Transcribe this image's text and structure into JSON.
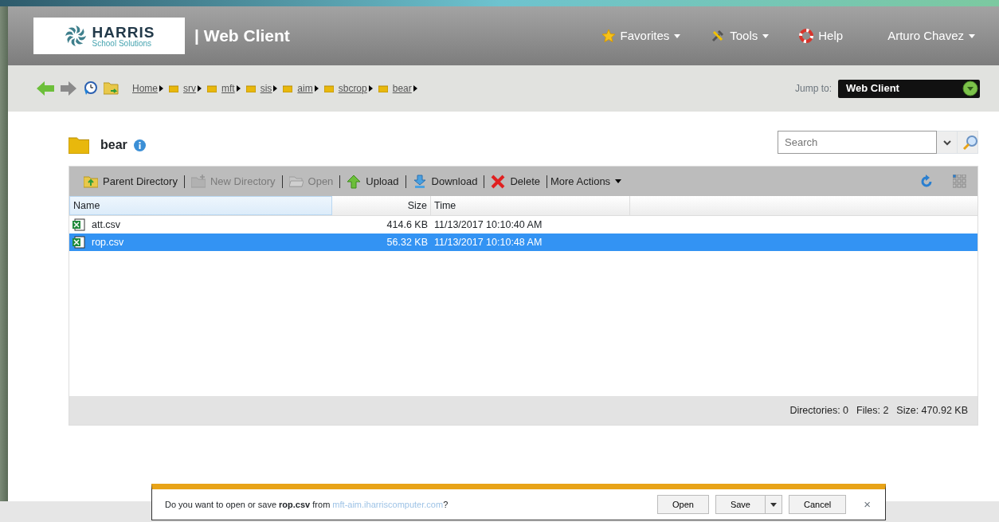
{
  "header": {
    "logo": {
      "name": "HARRIS",
      "tagline": "School Solutions"
    },
    "app_title": "| Web Client",
    "menu": [
      {
        "kind": "favorites",
        "label": "Favorites",
        "dropdown": true
      },
      {
        "kind": "tools",
        "label": "Tools",
        "dropdown": true
      },
      {
        "kind": "help",
        "label": "Help",
        "dropdown": false
      },
      {
        "kind": "user",
        "label": "Arturo Chavez",
        "dropdown": true
      }
    ]
  },
  "breadcrumb": [
    "Home",
    "srv",
    "mft",
    "sis",
    "aim",
    "sbcrop",
    "bear"
  ],
  "jump_to": {
    "label": "Jump to:",
    "value": "Web Client"
  },
  "folder": {
    "title": "bear"
  },
  "search": {
    "placeholder": "Search"
  },
  "toolbar": [
    {
      "kind": "parent",
      "label": "Parent Directory",
      "disabled": false
    },
    {
      "kind": "newdir",
      "label": "New Directory",
      "disabled": true
    },
    {
      "kind": "open",
      "label": "Open",
      "disabled": true
    },
    {
      "kind": "upload",
      "label": "Upload",
      "disabled": false
    },
    {
      "kind": "download",
      "label": "Download",
      "disabled": false
    },
    {
      "kind": "delete",
      "label": "Delete",
      "disabled": false
    },
    {
      "kind": "more",
      "label": "More Actions",
      "disabled": false
    }
  ],
  "table": {
    "columns": [
      "Name",
      "Size",
      "Time"
    ],
    "rows": [
      {
        "name": "att.csv",
        "size": "414.6 KB",
        "time": "11/13/2017 10:10:40 AM",
        "selected": false
      },
      {
        "name": "rop.csv",
        "size": "56.32 KB",
        "time": "11/13/2017 10:10:48 AM",
        "selected": true
      }
    ]
  },
  "status_bar": [
    "Directories: 0",
    "Files: 2",
    "Size: 470.92 KB"
  ],
  "download_bar": {
    "message": "Do you want to open or save **rop.csv** from ",
    "url": "mft-aim.iharriscomputer.com",
    "end": "?",
    "buttons": [
      "Open",
      "Save",
      "Cancel"
    ],
    "close": "×"
  }
}
